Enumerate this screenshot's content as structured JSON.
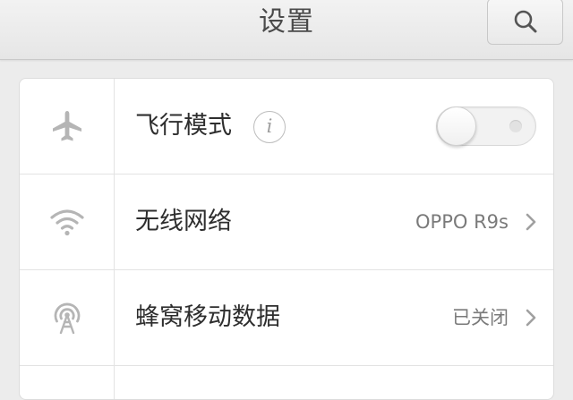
{
  "header": {
    "title": "设置",
    "search_icon": "search-icon"
  },
  "settings": {
    "items": [
      {
        "icon": "airplane-icon",
        "label": "飞行模式",
        "info_icon": "info-icon",
        "info_glyph": "i",
        "toggle_on": false
      },
      {
        "icon": "wifi-icon",
        "label": "无线网络",
        "value": "OPPO R9s",
        "chevron": "chevron-right-icon"
      },
      {
        "icon": "cellular-antenna-icon",
        "label": "蜂窝移动数据",
        "value": "已关闭",
        "chevron": "chevron-right-icon"
      }
    ]
  },
  "colors": {
    "background": "#ececec",
    "card": "#ffffff",
    "icon_gray": "#b5b5b5",
    "text": "#2e2e2e",
    "value_text": "#7a7a7a"
  }
}
